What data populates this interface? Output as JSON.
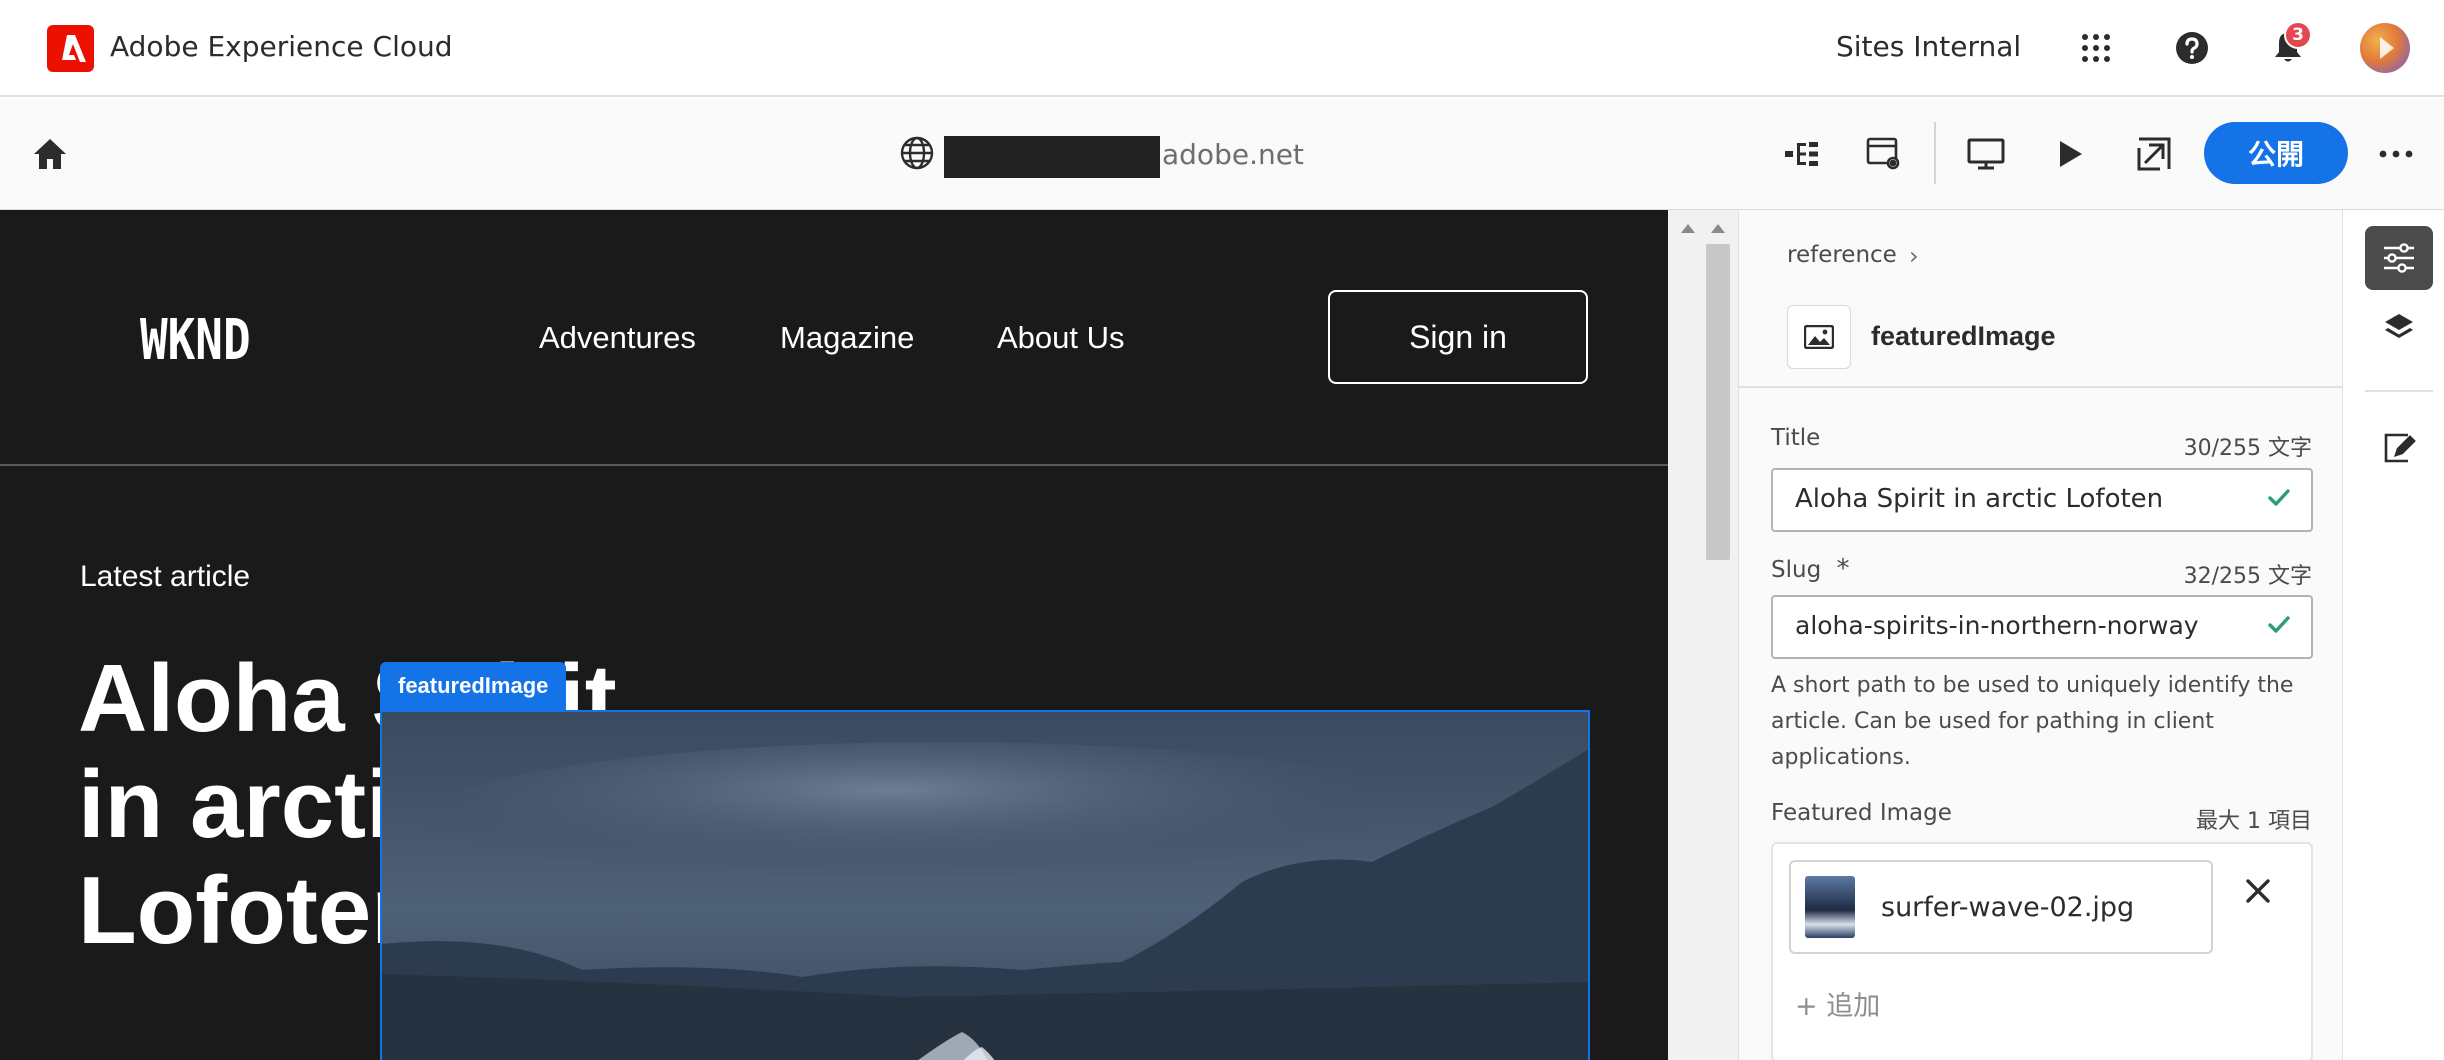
{
  "shell": {
    "app_title": "Adobe Experience Cloud",
    "org_name": "Sites Internal",
    "notification_count": "3",
    "brand_color": "#eb1000"
  },
  "toolbar": {
    "url_text": "adobe.net",
    "publish_label": "公開",
    "accent_color": "#1473e6"
  },
  "preview": {
    "logo": "WKND",
    "nav": [
      "Adventures",
      "Magazine",
      "About Us"
    ],
    "signin_label": "Sign in",
    "eyebrow": "Latest article",
    "headline_lines": [
      "Aloha Spirit",
      "in arctic",
      "Lofoten"
    ],
    "selected_component_tag": "featuredImage"
  },
  "panel": {
    "breadcrumb": "reference",
    "component_name": "featuredImage",
    "fields": {
      "title": {
        "label": "Title",
        "count": "30/255 文字",
        "value": "Aloha Spirit in arctic Lofoten"
      },
      "slug": {
        "label": "Slug",
        "required_marker": "*",
        "count": "32/255 文字",
        "value": "aloha-spirits-in-northern-norway",
        "help": "A short path to be used to uniquely identify the article. Can be used for pathing in client applications."
      },
      "featured_image": {
        "label": "Featured Image",
        "limit": "最大 1 項目",
        "asset_name": "surfer-wave-02.jpg",
        "add_label": "+ 追加"
      }
    },
    "valid_color": "#2d9d78"
  }
}
